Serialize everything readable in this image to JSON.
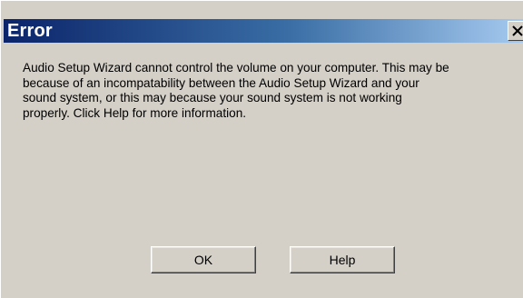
{
  "dialog": {
    "title": "Error",
    "close_glyph": "X",
    "close_icon": "close-icon",
    "message_lines": [
      "Audio Setup Wizard cannot control the volume on your computer. This may be",
      "because of an incompatability between the Audio Setup Wizard and your",
      "sound system, or this may because your sound system is not working",
      "properly. Click Help for more information."
    ],
    "ok_label": "OK",
    "help_label": "Help"
  },
  "colors": {
    "titlebar_start": "#0b246a",
    "titlebar_end": "#a6caf0",
    "dialog_face": "#d4d0c8"
  }
}
